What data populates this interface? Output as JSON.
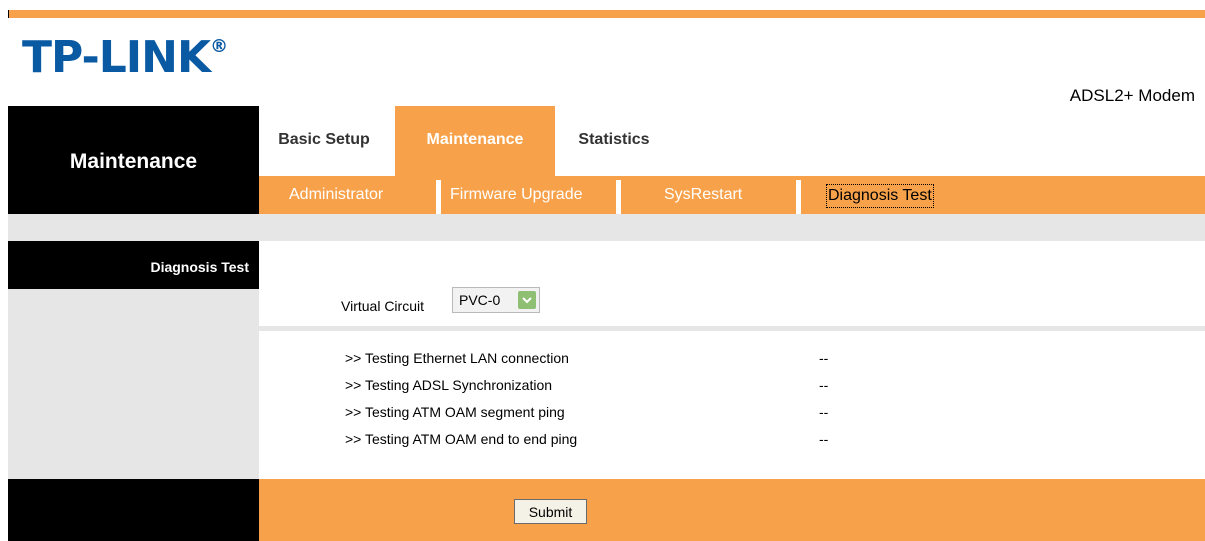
{
  "brand": {
    "logo": "TP-LINK",
    "logo_mark": "®",
    "product": "ADSL2+ Modem"
  },
  "nav": {
    "section_title": "Maintenance",
    "tabs": [
      {
        "label": "Basic Setup",
        "active": false
      },
      {
        "label": "Maintenance",
        "active": true
      },
      {
        "label": "Statistics",
        "active": false
      }
    ],
    "subnav": [
      {
        "label": "Administrator",
        "active": false
      },
      {
        "label": "Firmware Upgrade",
        "active": false
      },
      {
        "label": "SysRestart",
        "active": false
      },
      {
        "label": "Diagnosis Test",
        "active": true
      }
    ]
  },
  "sidebar": {
    "page_label": "Diagnosis Test"
  },
  "form": {
    "virtual_circuit_label": "Virtual Circuit",
    "virtual_circuit_value": "PVC-0"
  },
  "tests": [
    {
      "label": ">> Testing Ethernet LAN connection",
      "result": "--"
    },
    {
      "label": ">> Testing ADSL Synchronization",
      "result": "--"
    },
    {
      "label": ">> Testing ATM OAM segment ping",
      "result": "--"
    },
    {
      "label": ">> Testing ATM OAM end to end ping",
      "result": "--"
    }
  ],
  "actions": {
    "submit_label": "Submit"
  },
  "colors": {
    "accent": "#f7a24b",
    "brand_blue": "#0a5aa3",
    "panel": "#000000",
    "band": "#e6e6e6"
  }
}
